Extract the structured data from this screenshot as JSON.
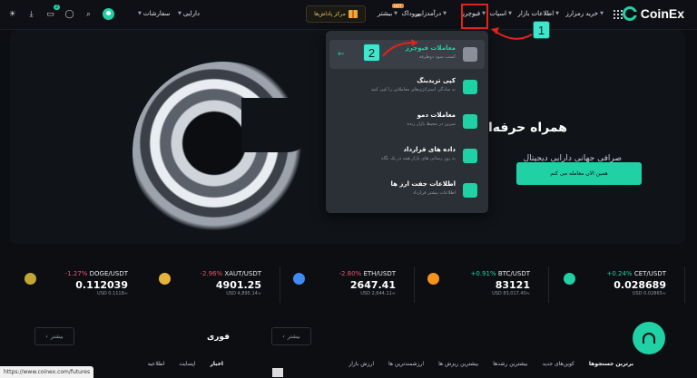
{
  "nav": {
    "logo": "CoinEx",
    "menu": [
      {
        "label": "خرید رمزارز",
        "has_caret": true
      },
      {
        "label": "اطلاعات بازار",
        "has_caret": true
      },
      {
        "label": "اسپات",
        "has_caret": true
      },
      {
        "label": "فیوچرز",
        "has_caret": true
      },
      {
        "label": "درآمدزایی",
        "has_caret": true
      },
      {
        "label": "پروداک",
        "has_caret": false
      },
      {
        "label": "بیشتر",
        "has_caret": true
      }
    ],
    "hot_badge": "HOT",
    "gift_label": "مرکز پاداش‌ها",
    "right_user": [
      {
        "label": "سفارشات",
        "has_caret": true
      },
      {
        "label": "دارایی",
        "has_caret": true
      }
    ],
    "notification_count": "2"
  },
  "hero": {
    "title": "همراه حرفه‌ای شما در",
    "subtitle": "صرافی جهانی دارایی دیجیتال",
    "cta": "همین الان معامله می کنم"
  },
  "dropdown": {
    "items": [
      {
        "title": "معاملات فیوچرز",
        "desc": "کسب سود دوطرفه",
        "active": true,
        "icon_color": "#8a9099"
      },
      {
        "title": "کپی تریدینگ",
        "desc": "به سادگی استراتژی‌های معاملاتی را کپی کنید",
        "active": false,
        "icon_color": "#1fd1a5"
      },
      {
        "title": "معاملات دمو",
        "desc": "تمرین در محیط بازار زنده",
        "active": false,
        "icon_color": "#1fd1a5"
      },
      {
        "title": "داده های قرارداد",
        "desc": "به روز رسانی های بازار همه در یک نگاه",
        "active": false,
        "icon_color": "#1fd1a5"
      },
      {
        "title": "اطلاعات جفت ارز ها",
        "desc": "اطلاعات بیشتر قرارداد",
        "active": false,
        "icon_color": "#1fd1a5"
      }
    ]
  },
  "annotations": {
    "step1": "1",
    "step2": "2"
  },
  "ticker": [
    {
      "pair": "CET/USDT",
      "change": "+0.24%",
      "price": "0.028689",
      "usd": "USD 0.02865≈",
      "coin_color": "#1fd1a5",
      "neg": false
    },
    {
      "pair": "BTC/USDT",
      "change": "+0.91%",
      "price": "83121",
      "usd": "USD 83,017.40≈",
      "coin_color": "#f7931a",
      "neg": false
    },
    {
      "pair": "ETH/USDT",
      "change": "-2.80%",
      "price": "2647.41",
      "usd": "USD 2,644.11≈",
      "coin_color": "#3e8bf2",
      "neg": true
    },
    {
      "pair": "XAUT/USDT",
      "change": "-2.96%",
      "price": "4901.25",
      "usd": "USD 4,895.14≈",
      "coin_color": "#e8b23a",
      "neg": true
    },
    {
      "pair": "DOGE/USDT",
      "change": "-1.27%",
      "price": "0.112039",
      "usd": "USD 0.1118≈",
      "coin_color": "#c2a633",
      "neg": true
    }
  ],
  "bottom": {
    "more_label": "بیشتر",
    "section_title": "فوری",
    "market_tabs": [
      "برترین جستجوها",
      "کوین‌های جدید",
      "بیشترین رشدها",
      "بیشترین ریزش ها",
      "ارزشمندترین ها",
      "ارزش بازار"
    ],
    "news_tabs": [
      "اخبار",
      "اپسایت",
      "اطلاعیه"
    ],
    "status_url": "https://www.coinex.com/futures"
  }
}
